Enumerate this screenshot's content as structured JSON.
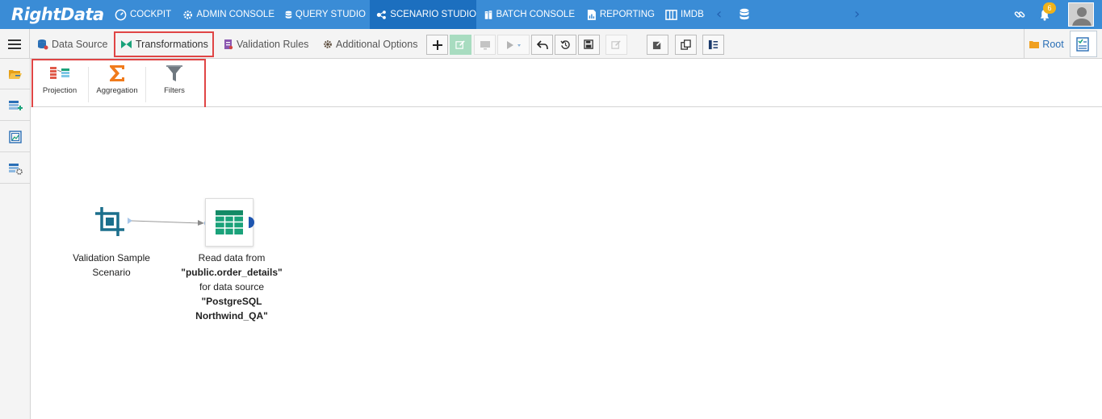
{
  "app": {
    "logo_text": "RightData"
  },
  "topnav": {
    "items": [
      {
        "label": "COCKPIT",
        "icon": "gauge-icon"
      },
      {
        "label": "ADMIN CONSOLE",
        "icon": "gear-icon"
      },
      {
        "label": "QUERY STUDIO",
        "icon": "database-icon"
      },
      {
        "label": "SCENARIO STUDIO",
        "icon": "scenario-icon",
        "active": true
      },
      {
        "label": "BATCH CONSOLE",
        "icon": "batch-icon"
      },
      {
        "label": "REPORTING",
        "icon": "report-icon"
      },
      {
        "label": "IMDB",
        "icon": "imdb-icon"
      }
    ],
    "notification_count": "6"
  },
  "toolbar": {
    "tabs": [
      {
        "label": "Data Source",
        "icon": "database-icon"
      },
      {
        "label": "Transformations",
        "icon": "bowtie-icon",
        "highlighted": true
      },
      {
        "label": "Validation Rules",
        "icon": "rules-icon"
      },
      {
        "label": "Additional Options",
        "icon": "gear-icon"
      }
    ],
    "root_label": "Root"
  },
  "palette": {
    "items": [
      {
        "label": "Projection",
        "icon": "projection-icon"
      },
      {
        "label": "Aggregation",
        "icon": "sigma-icon"
      },
      {
        "label": "Filters",
        "icon": "filter-icon"
      }
    ]
  },
  "canvas": {
    "node1": {
      "label_line1": "Validation Sample",
      "label_line2": "Scenario"
    },
    "node2": {
      "line1": "Read data from",
      "line2": "\"public.order_details\"",
      "line3": "for data source",
      "line4": "\"PostgreSQL",
      "line5": "Northwind_QA\""
    }
  },
  "colors": {
    "topbar": "#3a8cd6",
    "active_tab": "#1c6fbf",
    "highlight": "#e04545",
    "node_teal": "#1b6f8c",
    "sheet_green": "#1aa27a"
  }
}
